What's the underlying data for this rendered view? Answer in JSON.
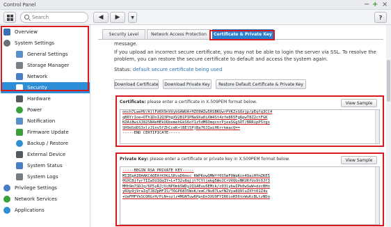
{
  "window": {
    "title": "Control Panel",
    "min": "−",
    "max": "+",
    "close": "×"
  },
  "toolbar": {
    "search_placeholder": "Search",
    "back": "◀",
    "forward": "▶",
    "dropdown": "▼",
    "help": "?"
  },
  "sidebar": {
    "items": [
      {
        "label": "Overview",
        "icon": "overview-icon",
        "color": "#3b6fb6"
      },
      {
        "label": "System Settings",
        "icon": "gear-icon",
        "color": "#6a7178"
      },
      {
        "label": "General Settings",
        "icon": "general-settings-icon",
        "color": "#5a8fc8"
      },
      {
        "label": "Storage Manager",
        "icon": "storage-icon",
        "color": "#7a7f85"
      },
      {
        "label": "Network",
        "icon": "network-icon",
        "color": "#4a7ec4"
      },
      {
        "label": "Security",
        "icon": "security-icon",
        "color": "#ffffff"
      },
      {
        "label": "Hardware",
        "icon": "hardware-icon",
        "color": "#555a60"
      },
      {
        "label": "Power",
        "icon": "power-icon",
        "color": "#3aa13a"
      },
      {
        "label": "Notification",
        "icon": "notification-icon",
        "color": "#5a8fc8"
      },
      {
        "label": "Firmware Update",
        "icon": "firmware-icon",
        "color": "#3aa13a"
      },
      {
        "label": "Backup / Restore",
        "icon": "backup-icon",
        "color": "#2f8fd0"
      },
      {
        "label": "External Device",
        "icon": "external-device-icon",
        "color": "#555a60"
      },
      {
        "label": "System Status",
        "icon": "system-status-icon",
        "color": "#4a7ec4"
      },
      {
        "label": "System Logs",
        "icon": "system-logs-icon",
        "color": "#777c82"
      },
      {
        "label": "Privilege Settings",
        "icon": "privilege-icon",
        "color": "#4a7ec4"
      },
      {
        "label": "Network Services",
        "icon": "network-services-icon",
        "color": "#3aa13a"
      },
      {
        "label": "Applications",
        "icon": "applications-icon",
        "color": "#2f8fd0"
      }
    ]
  },
  "tabs": [
    {
      "label": "Security Level"
    },
    {
      "label": "Network Access Protection"
    },
    {
      "label": "Certificate & Private Key"
    }
  ],
  "content": {
    "message_tail": "message.",
    "warning": "If you upload an incorrect secure certificate, you may not be able to login the server via SSL. To resolve the problem, you can restore the secure certificate to default and access the system again.",
    "status_label": "Status:",
    "status_value": "default secure certificate being used",
    "buttons": {
      "download_cert": "Download Certificate",
      "download_key": "Download Private Key",
      "restore": "Restore Default Certificate & Private Key"
    }
  },
  "certificate": {
    "label": "Certificate:",
    "hint": "please enter a certificate in X.509PEM format below.",
    "view_sample": "View Sample",
    "lines": [
      "onch7LweHV/AllFd0X9nVVybGAWUArHZO9WZw5RSBKUwrPVKZsGOzjp/pEqfq3CC4",
      "qB6YrIoe+OTh1DoI2Q3PhgXV2B1P1PNa9Xa0iXW4St4zfe865Fg6pwT8Z2ctFGK",
      "KOAiBwiXJ82SN4eHEkUQbemehGkS6oY1z5dM6OmqcnrPjeaSGgSOT/BRRipPStgx",
      "SH9dSdDS3xlzJ1nv5fZhCceK+lBEl5PjBa76JIwiH6rrkmacQ==",
      "-----END CERTIFICATE-----"
    ]
  },
  "private_key": {
    "label": "Private Key:",
    "hint": "please enter a certificate or private key in X.509PEM format below.",
    "view_sample": "View Sample",
    "lines": [
      "-----BEGIN RSA PRIVATE KEY-----",
      "MIIEpAIBAAKCAQEAtK0GLSRvaD6msc RWPKowQMWff0S5mF0WqKcn49aiHYmZKE5",
      "0GXCBjfyr7IIw5U1QqIY+L+T32v8qjjt7CYljakg5WoJCrUVQGvNKU6fUx9tOJf3",
      "MHh9m7SDJq/6P5yRJjVcNPOmbSWDy2Q1AEuu5EMik/c03lybwIPk0wSwW+dzcBHn",
      "yRXp9j9raIqTJ8ZpHFIS/T6GP6835WoK/emC/Nv87LwfN2Vya8Q9luZXYt01Z4u",
      "+UeFMFYkSCORGrH/PiN+ozlz4MGNTuw6PpnDn3XU9FYIR6ioR56tnWuKcBLtzNDo"
    ]
  }
}
